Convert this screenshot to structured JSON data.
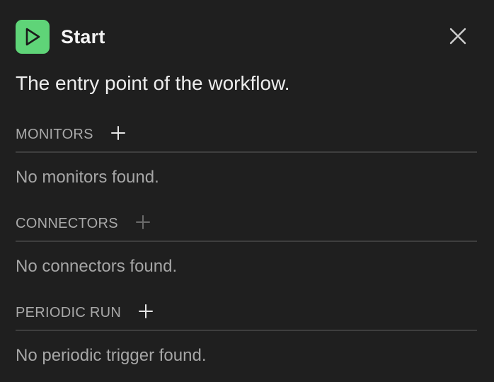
{
  "node": {
    "title": "Start",
    "description": "The entry point of the workflow.",
    "icon": "play-icon",
    "icon_bg": "#5fd478",
    "icon_fg": "#1b1b1b"
  },
  "close": {
    "icon": "close-icon"
  },
  "sections": [
    {
      "label": "MONITORS",
      "empty_text": "No monitors found.",
      "add_enabled": true
    },
    {
      "label": "CONNECTORS",
      "empty_text": "No connectors found.",
      "add_enabled": false
    },
    {
      "label": "PERIODIC RUN",
      "empty_text": "No periodic trigger found.",
      "add_enabled": true
    }
  ],
  "colors": {
    "background": "#1f1f1f",
    "divider": "#3e3e3e",
    "muted_text": "#a6a6a6",
    "add_enabled": "#e6e6e6",
    "add_disabled": "#6a6a6a"
  }
}
